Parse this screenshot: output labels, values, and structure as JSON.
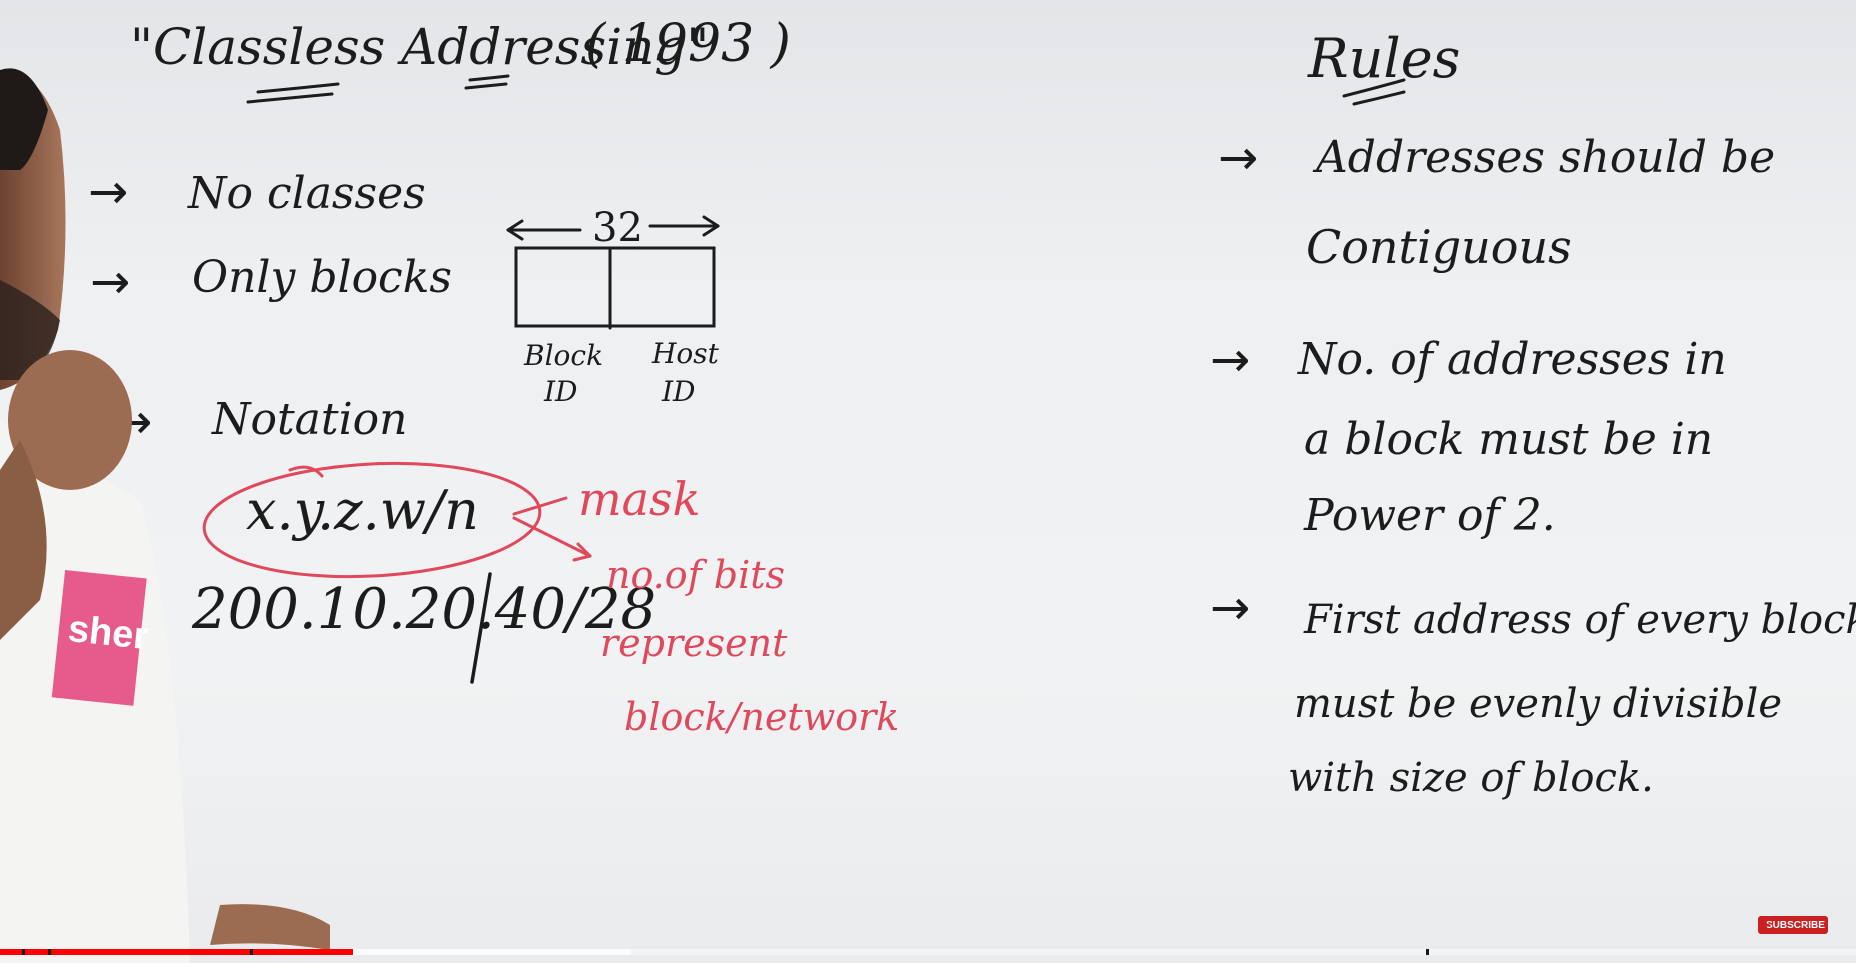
{
  "lecture": {
    "title": "\"Classless Addressing\"",
    "year": "( 1993 )",
    "points": [
      "No classes",
      "Only blocks",
      "Notation"
    ],
    "diagram": {
      "bits": "32",
      "left_label": [
        "Block",
        "ID"
      ],
      "right_label": [
        "Host",
        "ID"
      ]
    },
    "notation_formula": "x.y.z.w/n",
    "example_address": "200.10.20.40/28",
    "mask_label": "mask",
    "annotation": [
      "no.of bits",
      "represent",
      "block/network"
    ]
  },
  "rules": {
    "heading": "Rules",
    "rule1": [
      "Addresses should be",
      "Contiguous"
    ],
    "rule2": [
      "No. of addresses in",
      "a block must be in",
      "Power of 2."
    ],
    "rule3": [
      "First address of every block",
      "must be evenly divisible",
      "with size of block."
    ]
  },
  "presenter_shirt_text": "sher",
  "player": {
    "subscribe_label": "SUBSCRIBE",
    "progress_played_fraction": 0.19,
    "progress_buffered_fraction": 0.34,
    "progress_color": "#ff0000"
  }
}
